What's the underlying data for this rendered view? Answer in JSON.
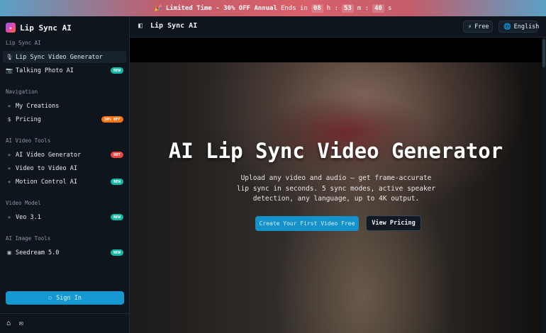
{
  "promo": {
    "emoji": "🎉",
    "headline": "Limited Time - 30% OFF Annual",
    "ends_in": "Ends in",
    "hours": "08",
    "h_label": "h :",
    "minutes": "53",
    "m_label": "m :",
    "seconds": "40",
    "s_label": "s"
  },
  "brand": {
    "name": "Lip Sync AI",
    "logo_glyph": "✦"
  },
  "sidebar": {
    "section_lipsync": "Lip Sync AI",
    "item_lipsync_generator": "Lip Sync Video Generator",
    "item_talking_photo": "Talking Photo AI",
    "badge_talking_photo": "NEW",
    "section_navigation": "Navigation",
    "item_my_creations": "My Creations",
    "item_pricing": "Pricing",
    "badge_pricing": "30% OFF",
    "section_video_tools": "AI Video Tools",
    "item_ai_video_generator": "AI Video Generator",
    "badge_ai_video_generator": "HOT",
    "item_video_to_video": "Video to Video AI",
    "item_motion_control": "Motion Control AI",
    "badge_motion_control": "NEW",
    "section_video_model": "Video Model",
    "item_veo": "Veo 3.1",
    "badge_veo": "NEW",
    "section_image_tools": "AI Image Tools",
    "item_seedream": "Seedream 5.0",
    "badge_seedream": "NEW",
    "signin_label": "Sign In"
  },
  "topbar": {
    "title": "Lip Sync AI",
    "free_label": "Free",
    "language_label": "English"
  },
  "hero": {
    "title": "AI Lip Sync Video Generator",
    "subtitle": "Upload any video and audio — get frame-accurate lip sync in seconds. 5 sync modes, active speaker detection, any language, up to 4K output.",
    "primary_cta": "Create Your First Video Free",
    "secondary_cta": "View Pricing"
  },
  "colors": {
    "accent": "#1597d2",
    "badge_new": "#14b8a6",
    "badge_hot": "#ef4444",
    "badge_off": "#f97316",
    "sidebar_bg": "#0e151d"
  },
  "icons": {
    "mic": "mic-icon",
    "camera": "camera-icon",
    "sparkle": "sparkle-icon",
    "dollar": "dollar-icon",
    "image": "image-icon",
    "user": "user-icon",
    "home": "home-icon",
    "mail": "mail-icon",
    "panel": "panel-icon",
    "bolt": "bolt-icon",
    "globe": "globe-icon"
  }
}
